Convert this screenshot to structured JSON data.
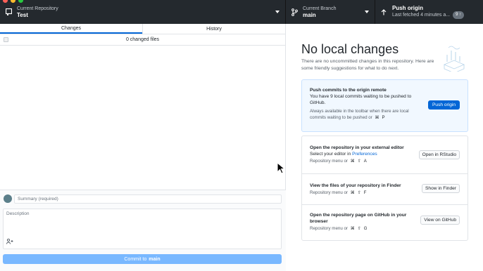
{
  "toolbar": {
    "repo_label": "Current Repository",
    "repo_name": "Test",
    "branch_label": "Current Branch",
    "branch_name": "main",
    "push_title": "Push origin",
    "push_sub": "Last fetched 4 minutes a...",
    "push_badge": "9 ↑"
  },
  "tabs": {
    "changes": "Changes",
    "history": "History"
  },
  "changes": {
    "count_label": "0 changed files"
  },
  "commit": {
    "summary_placeholder": "Summary (required)",
    "description_placeholder": "Description",
    "button_prefix": "Commit to",
    "button_branch": "main"
  },
  "empty": {
    "title": "No local changes",
    "subtitle": "There are no uncommitted changes in this repository. Here are some friendly suggestions for what to do next."
  },
  "push_card": {
    "title": "Push commits to the origin remote",
    "desc": "You have 9 local commits waiting to be pushed to GitHub.",
    "hint": "Always available in the toolbar when there are local commits waiting to be pushed or",
    "keys": [
      "⌘",
      "P"
    ],
    "button": "Push origin"
  },
  "suggestions": [
    {
      "title": "Open the repository in your external editor",
      "desc_prefix": "Select your editor in ",
      "desc_link": "Preferences",
      "hint": "Repository menu or",
      "keys": [
        "⌘",
        "⇧",
        "A"
      ],
      "button": "Open in RStudio"
    },
    {
      "title": "View the files of your repository in Finder",
      "hint": "Repository menu or",
      "keys": [
        "⌘",
        "⇧",
        "F"
      ],
      "button": "Show in Finder"
    },
    {
      "title": "Open the repository page on GitHub in your browser",
      "hint": "Repository menu or",
      "keys": [
        "⌘",
        "⇧",
        "G"
      ],
      "button": "View on GitHub"
    }
  ],
  "colors": {
    "toolbar": "#24292e",
    "accent": "#0366d6",
    "commit_disabled": "#79b8ff"
  }
}
